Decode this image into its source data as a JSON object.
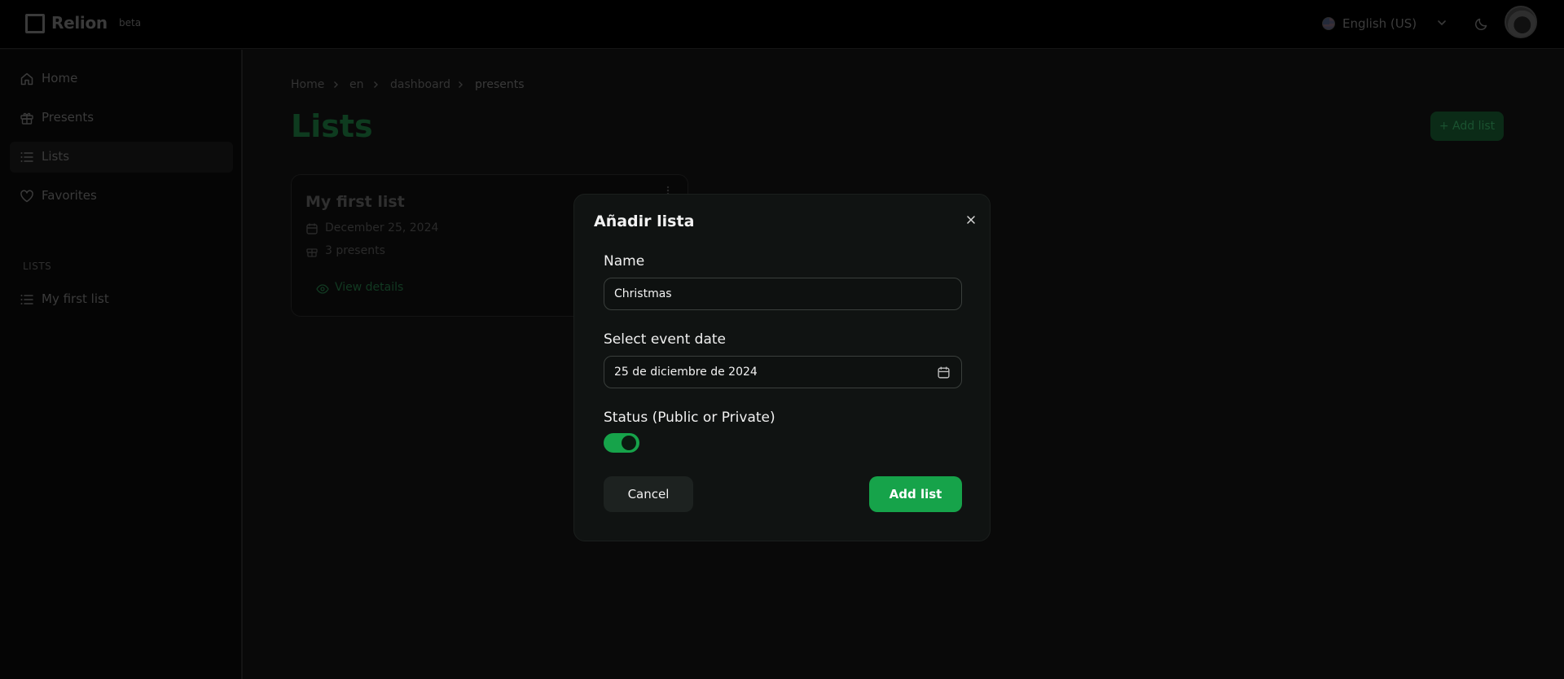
{
  "header": {
    "logo_text": "Relion",
    "badge": "beta",
    "language": "English (US)",
    "icons": {
      "flag": "us-flag-icon",
      "language_dropdown": "chevron-down-icon",
      "theme": "moon-icon",
      "avatar": "avatar"
    }
  },
  "sidebar": {
    "items": [
      {
        "label": "Home",
        "icon": "home-icon"
      },
      {
        "label": "Presents",
        "icon": "gift-icon"
      },
      {
        "label": "Lists",
        "icon": "list-icon",
        "active": true
      },
      {
        "label": "Favorites",
        "icon": "heart-icon"
      }
    ],
    "section_label": "LISTS",
    "lists": [
      {
        "label": "My first list",
        "icon": "list-icon"
      }
    ]
  },
  "breadcrumb": [
    "Home",
    "en",
    "dashboard",
    "presents"
  ],
  "main": {
    "title": "Lists",
    "add_button": "+ Add list",
    "card": {
      "title": "My first list",
      "date": "December 25, 2024",
      "count": "3 presents",
      "link": "View details"
    }
  },
  "modal": {
    "title": "Añadir lista",
    "name_label": "Name",
    "name_value": "Christmas",
    "date_label": "Select event date",
    "date_value": "25 de diciembre de 2024",
    "status_label": "Status (Public or Private)",
    "status_on": true,
    "cancel": "Cancel",
    "submit": "Add list"
  },
  "colors": {
    "accent": "#16a34a",
    "background": "#090909",
    "modal_bg": "#101312"
  }
}
